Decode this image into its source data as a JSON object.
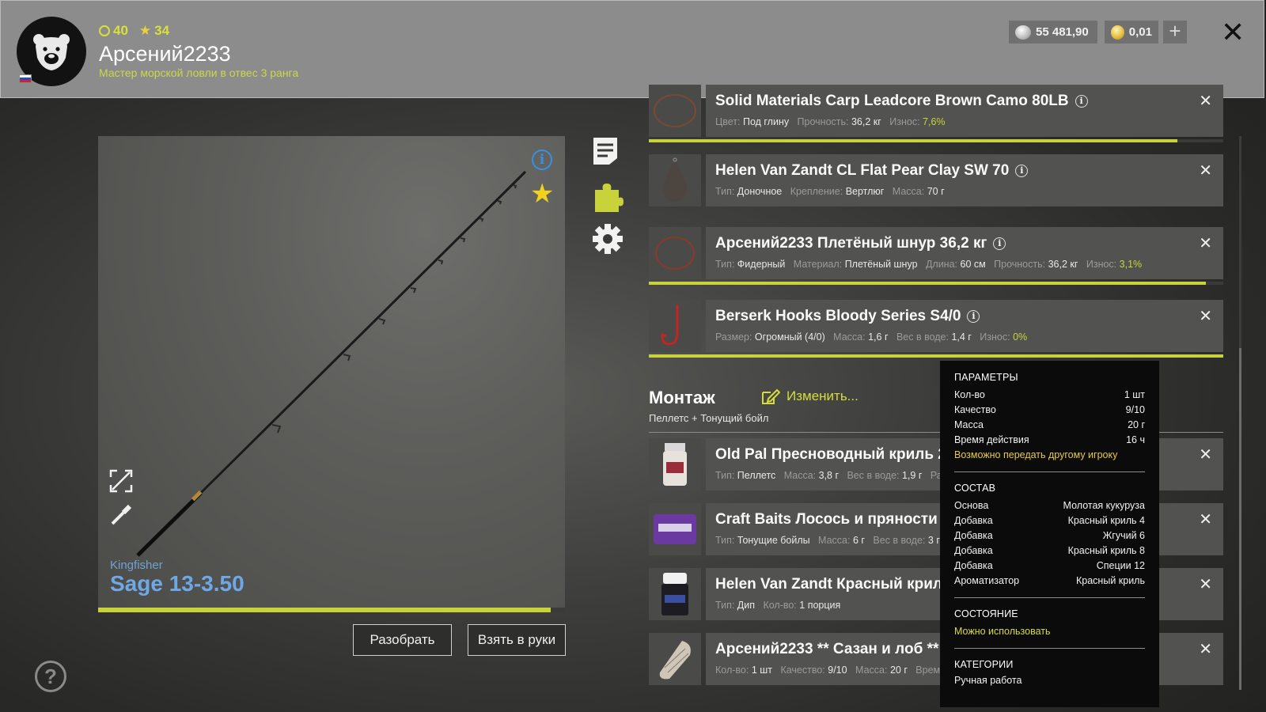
{
  "header": {
    "level": "40",
    "rank": "34",
    "username": "Арсений2233",
    "title": "Мастер морской ловли в отвес 3 ранга",
    "silver": "55 481,90",
    "gold": "0,01",
    "plus": "+",
    "close": "✕"
  },
  "preview": {
    "brand": "Kingfisher",
    "rod_name": "Sage 13-3.50",
    "condition_fraction": 0.97,
    "info": "i",
    "disassemble_label": "Разобрать",
    "take_label": "Взять в руки"
  },
  "gear": [
    {
      "name": "Solid Materials Carp Leadcore Brown Camo 80LB",
      "props": [
        [
          "Цвет:",
          "Под глину"
        ],
        [
          "Прочность:",
          "36,2 кг"
        ],
        [
          "Износ:",
          "7,6%"
        ]
      ],
      "wear_fraction": 0.92
    },
    {
      "name": "Helen Van Zandt CL Flat Pear Clay SW 70",
      "props": [
        [
          "Тип:",
          "Доночное"
        ],
        [
          "Крепление:",
          "Вертлюг"
        ],
        [
          "Масса:",
          "70 г"
        ]
      ]
    },
    {
      "name": "Арсений2233 Плетёный шнур 36,2 кг",
      "props": [
        [
          "Тип:",
          "Фидерный"
        ],
        [
          "Материал:",
          "Плетёный шнур"
        ],
        [
          "Длина:",
          "60 см"
        ],
        [
          "Прочность:",
          "36,2 кг"
        ],
        [
          "Износ:",
          "3,1%"
        ]
      ],
      "wear_fraction": 0.97
    },
    {
      "name": "Berserk Hooks Bloody Series S4/0",
      "props": [
        [
          "Размер:",
          "Огромный (4/0)"
        ],
        [
          "Масса:",
          "1,6 г"
        ],
        [
          "Вес в воде:",
          "1,4 г"
        ],
        [
          "Износ:",
          "0%"
        ]
      ],
      "wear_fraction": 1.0
    }
  ],
  "montage": {
    "title": "Монтаж",
    "edit_label": "Изменить...",
    "subtitle": "Пеллетс + Тонущий бойл"
  },
  "baits": [
    {
      "name": "Old Pal Пресноводный криль 25",
      "props": [
        [
          "Тип:",
          "Пеллетс"
        ],
        [
          "Масса:",
          "3,8 г"
        ],
        [
          "Вес в воде:",
          "1,9 г"
        ],
        [
          "Разм",
          ""
        ]
      ]
    },
    {
      "name": "Craft Baits Лосось и пряности 26",
      "props": [
        [
          "Тип:",
          "Тонущие бойлы"
        ],
        [
          "Масса:",
          "6 г"
        ],
        [
          "Вес в воде:",
          "3 г"
        ]
      ]
    },
    {
      "name": "Helen Van Zandt Красный криль",
      "props": [
        [
          "Тип:",
          "Дип"
        ],
        [
          "Кол-во:",
          "1 порция"
        ]
      ]
    },
    {
      "name": "Арсений2233 ** Сазан и лоб **",
      "props": [
        [
          "Кол-во:",
          "1 шт"
        ],
        [
          "Качество:",
          "9/10"
        ],
        [
          "Масса:",
          "20 г"
        ],
        [
          "Время",
          ""
        ]
      ]
    }
  ],
  "tooltip": {
    "params_title": "ПАРАМЕТРЫ",
    "params": [
      [
        "Кол-во",
        "1 шт"
      ],
      [
        "Качество",
        "9/10"
      ],
      [
        "Масса",
        "20 г"
      ],
      [
        "Время действия",
        "16 ч"
      ]
    ],
    "transfer_note": "Возможно передать другому игроку",
    "composition_title": "СОСТАВ",
    "composition": [
      [
        "Основа",
        "Молотая кукуруза"
      ],
      [
        "Добавка",
        "Красный криль 4"
      ],
      [
        "Добавка",
        "Жгучий 6"
      ],
      [
        "Добавка",
        "Красный криль 8"
      ],
      [
        "Добавка",
        "Специи 12"
      ],
      [
        "Ароматизатор",
        "Красный криль"
      ]
    ],
    "state_title": "СОСТОЯНИЕ",
    "state_value": "Можно использовать",
    "categories_title": "КАТЕГОРИИ",
    "categories_value": "Ручная работа"
  },
  "help": "?",
  "colors": {
    "accent": "#c8d33b",
    "rod_blue": "#6fa8e6",
    "gold_text": "#e6c94a"
  },
  "icons": [
    "bear-avatar-icon",
    "document-icon",
    "puzzle-icon",
    "gear-icon",
    "info-icon",
    "star-icon",
    "expand-icon",
    "brush-icon",
    "edit-icon",
    "help-icon"
  ]
}
